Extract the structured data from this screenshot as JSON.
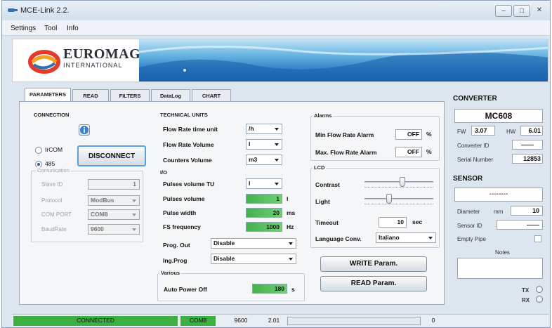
{
  "window": {
    "title": "MCE-Link 2.2."
  },
  "menu": {
    "items": [
      "Settings",
      "Tool",
      "Info"
    ]
  },
  "banner": {
    "brand": "EUROMAG",
    "sub": "INTERNATIONAL"
  },
  "tabs": [
    "PARAMETERS",
    "READ",
    "FILTERS",
    "DataLog",
    "CHART"
  ],
  "connection": {
    "title": "CONNECTION",
    "radio_ircom": "IrCOM",
    "radio_485": "485",
    "selected": "485",
    "disconnect": "DISCONNECT",
    "comm_title": "Comunication",
    "slave_id_label": "Slave ID",
    "slave_id": "1",
    "protocol_label": "Protocol",
    "protocol": "ModBus",
    "com_port_label": "COM PORT",
    "com_port": "COM8",
    "baud_label": "BaudRate",
    "baud": "9600"
  },
  "technical_units": {
    "title": "TECHNICAL UNITS",
    "flow_rate_time_label": "Flow Rate time unit",
    "flow_rate_time": "/h",
    "flow_rate_volume_label": "Flow Rate Volume",
    "flow_rate_volume": "l",
    "counters_volume_label": "Counters Volume",
    "counters_volume": "m3"
  },
  "io": {
    "title": "I/O",
    "pulses_volume_tu_label": "Pulses volume TU",
    "pulses_volume_tu": "l",
    "pulses_volume_label": "Pulses volume",
    "pulses_volume": "1",
    "pulses_volume_unit": "l",
    "pulse_width_label": "Pulse width",
    "pulse_width": "20",
    "pulse_width_unit": "ms",
    "fs_frequency_label": "FS frequency",
    "fs_frequency": "1000",
    "fs_frequency_unit": "Hz",
    "prog_out_label": "Prog. Out",
    "prog_out": "Disable",
    "ing_prog_label": "Ing.Prog",
    "ing_prog": "Disable"
  },
  "various": {
    "title": "Various",
    "auto_power_off_label": "Auto Power Off",
    "auto_power_off": "180",
    "auto_power_off_unit": "s"
  },
  "alarms": {
    "title": "Alarms",
    "min_label": "Min Flow Rate Alarm",
    "min_value": "OFF",
    "max_label": "Max. Flow Rate Alarm",
    "max_value": "OFF",
    "unit": "%"
  },
  "lcd": {
    "title": "LCD",
    "contrast_label": "Contrast",
    "contrast_level": 0.55,
    "light_label": "Light",
    "light_level": 0.35,
    "timeout_label": "Timeout",
    "timeout": "10",
    "timeout_unit": "sec",
    "language_label": "Language Conv.",
    "language": "Italiano"
  },
  "actions": {
    "write": "WRITE Param.",
    "read": "READ Param."
  },
  "converter": {
    "title": "CONVERTER",
    "model": "MC608",
    "fw_label": "FW",
    "fw": "3.07",
    "hw_label": "HW",
    "hw": "6.01",
    "id_label": "Converter ID",
    "id": "——",
    "serial_label": "Serial Number",
    "serial": "12853"
  },
  "sensor": {
    "title": "SENSOR",
    "name": "--------",
    "diameter_label": "Diameter",
    "diameter_unit": "mm",
    "diameter": "10",
    "id_label": "Sensor ID",
    "id": "——",
    "empty_pipe_label": "Empty Pipe",
    "notes_label": "Notes"
  },
  "leds": {
    "tx": "TX",
    "rx": "RX"
  },
  "status": {
    "connected": "CONNECTED",
    "port": "COM8",
    "baud": "9600",
    "version": "2.01",
    "progress": "0",
    "progress_fraction": 0.0,
    "accent": "#3cb043"
  }
}
